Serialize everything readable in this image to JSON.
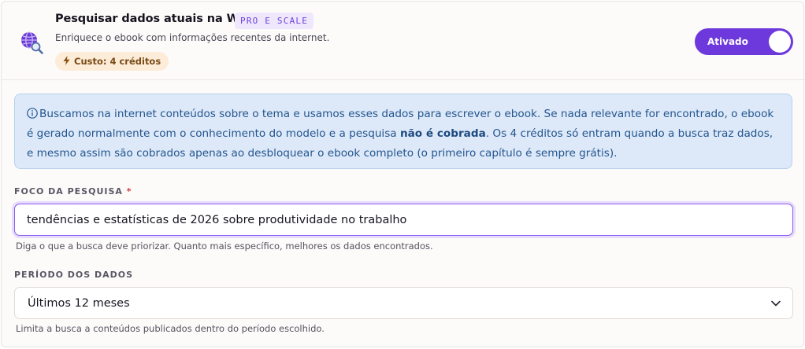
{
  "header": {
    "title": "Pesquisar dados atuais na Web",
    "plan_badge": "PRO E SCALE",
    "subtitle": "Enriquece o ebook com informações recentes da internet.",
    "cost_label": "Custo: 4 créditos",
    "toggle_label": "Ativado",
    "toggle_on": true
  },
  "info": {
    "text_before": "Buscamos na internet conteúdos sobre o tema e usamos esses dados para escrever o ebook. Se nada relevante for encontrado, o ebook é gerado normalmente com o conhecimento do modelo e a pesquisa ",
    "text_bold": "não é cobrada",
    "text_after": ". Os 4 créditos só entram quando a busca traz dados, e mesmo assim são cobrados apenas ao desbloquear o ebook completo (o primeiro capítulo é sempre grátis)."
  },
  "focus": {
    "label": "FOCO DA PESQUISA",
    "required_mark": "*",
    "value": "tendências e estatísticas de 2026 sobre produtividade no trabalho",
    "hint": "Diga o que a busca deve priorizar. Quanto mais específico, melhores os dados encontrados."
  },
  "period": {
    "label": "PERÍODO DOS DADOS",
    "selected": "Últimos 12 meses",
    "hint": "Limita a busca a conteúdos publicados dentro do período escolhido."
  },
  "colors": {
    "accent": "#6d38dc",
    "info_bg": "#dde9f8",
    "info_text": "#23558f",
    "cost_bg": "#fcecd8",
    "required": "#d23a3a"
  },
  "icons": {
    "feature": "globe-search-icon",
    "cost": "lightning-bolt-icon",
    "info": "info-circle-icon",
    "select": "chevron-down-icon"
  }
}
